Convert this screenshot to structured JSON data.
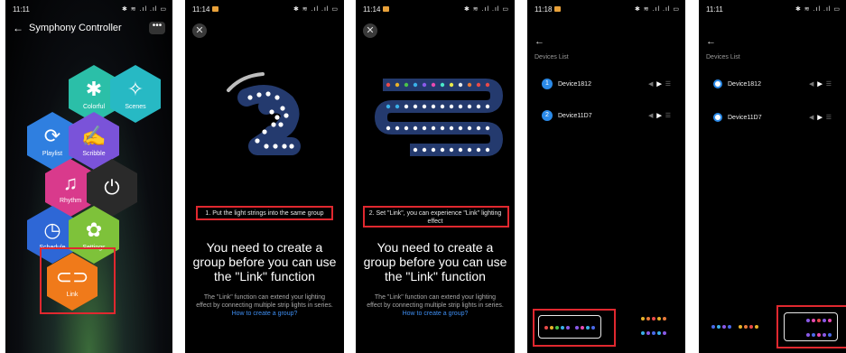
{
  "phone1": {
    "time": "11:11",
    "status_icons": "✱ ≋ .ıl .ıl ▭",
    "title": "Symphony Controller",
    "more": "•••",
    "tiles": [
      {
        "label": "Colorful",
        "icon": "asterisk-icon",
        "glyph": "✱",
        "color": "#2bbfa8"
      },
      {
        "label": "Scenes",
        "icon": "magic-wand-icon",
        "glyph": "✧",
        "color": "#27b9c4"
      },
      {
        "label": "Playlist",
        "icon": "refresh-icon",
        "glyph": "⟳",
        "color": "#2f7fe0"
      },
      {
        "label": "Scribble",
        "icon": "hand-draw-icon",
        "glyph": "✍",
        "color": "#7a53d9"
      },
      {
        "label": "Rhythm",
        "icon": "music-icon",
        "glyph": "♫",
        "color": "#d93a8c"
      },
      {
        "label": "",
        "icon": "power-icon",
        "glyph": "⏻",
        "color": "#2a2a2a"
      },
      {
        "label": "Schedule",
        "icon": "clock-icon",
        "glyph": "◷",
        "color": "#2e67d6"
      },
      {
        "label": "Settings",
        "icon": "gear-icon",
        "glyph": "✿",
        "color": "#7ec23a"
      },
      {
        "label": "Link",
        "icon": "link-icon",
        "glyph": "⊂⊃",
        "color": "#f07a1a"
      }
    ]
  },
  "phone2": {
    "time": "11:14",
    "status_icons": "✱ ≋ .ıl .ıl ▭",
    "close": "✕",
    "caption": "1. Put the light strings into the same group",
    "headline": "You need to create a group before you can use the \"Link\" function",
    "desc": "The \"Link\" function can extend your lighting effect by connecting multiple strip lights in series.",
    "desc_link": "How to create a group?"
  },
  "phone3": {
    "time": "11:14",
    "status_icons": "✱ ≋ .ıl .ıl ▭",
    "close": "✕",
    "caption": "2. Set \"Link\", you can experience \"Link\" lighting effect",
    "headline": "You need to create a group before you can use the \"Link\" function",
    "desc": "The \"Link\" function can extend your lighting effect by connecting multiple strip lights in series.",
    "desc_link": "How to create a group?"
  },
  "phone4": {
    "time": "11:18",
    "status_icons": "✱ ≋ .ıl .ıl ▭",
    "back": "←",
    "list_title": "Devices List",
    "devices": [
      {
        "index": "1",
        "name": "Device1812"
      },
      {
        "index": "2",
        "name": "Device11D7"
      }
    ]
  },
  "phone5": {
    "time": "11:11",
    "status_icons": "✱ ≋ .ıl .ıl ▭",
    "back": "←",
    "list_title": "Devices List",
    "devices": [
      {
        "name": "Device1812"
      },
      {
        "name": "Device11D7"
      }
    ]
  },
  "colors": {
    "highlight": "#e0282f",
    "accent_blue": "#2b8ae8",
    "link_blue": "#3e8ef2"
  }
}
